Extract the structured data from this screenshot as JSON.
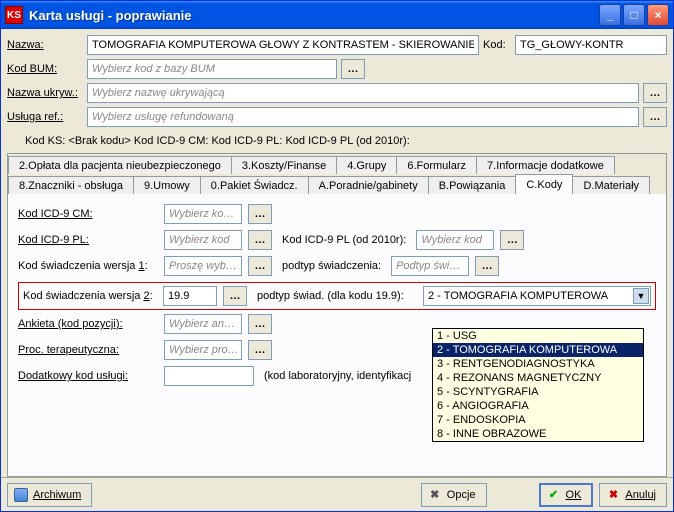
{
  "titlebar": {
    "app_icon_text": "KS",
    "title": "Karta usługi - poprawianie"
  },
  "fields": {
    "nazwa_label": "Nazwa:",
    "nazwa_value": "TOMOGRAFIA KOMPUTEROWA GŁOWY Z KONTRASTEM - SKIEROWANIE",
    "kod_label": "Kod:",
    "kod_value": "TG_GŁOWY-KONTR",
    "kod_bum_label": "Kod BUM:",
    "kod_bum_ph": "Wybierz kod z bazy BUM",
    "nazwa_ukryw_label": "Nazwa ukryw.:",
    "nazwa_ukryw_ph": "Wybierz nazwę ukrywającą",
    "usluga_ref_label": "Usługa ref.:",
    "usluga_ref_ph": "Wybierz usługę refundowaną",
    "kodrow": "Kod KS: <Brak kodu>   Kod ICD-9 CM:   Kod ICD-9 PL:   Kod ICD-9 PL (od 2010r):"
  },
  "tabs_row1": [
    "2.Opłata dla pacjenta nieubezpieczonego",
    "3.Koszty/Finanse",
    "4.Grupy",
    "6.Formularz",
    "7.Informacje dodatkowe"
  ],
  "tabs_row2": [
    "8.Znaczniki - obsługa",
    "9.Umowy",
    "0.Pakiet Świadcz.",
    "A.Poradnie/gabinety",
    "B.Powiązania",
    "C.Kody",
    "D.Materiały"
  ],
  "active_tab": "C.Kody",
  "pane": {
    "icd9cm_label": "Kod ICD-9 CM:",
    "icd9cm_ph": "Wybierz ko…",
    "icd9pl_label": "Kod ICD-9 PL:",
    "icd9pl_ph": "Wybierz kod",
    "icd9pl2010_label": "Kod ICD-9 PL (od 2010r):",
    "icd9pl2010_ph": "Wybierz kod",
    "kodsw1_label_pre": "Kod świadczenia wersja ",
    "kodsw1_label_u": "1",
    "kodsw1_label_post": ":",
    "kodsw1_ph": "Proszę wyb…",
    "podtyp_label": "podtyp świadczenia:",
    "podtyp_ph": "Podtyp świ…",
    "kodsw2_label_pre": "Kod świadczenia wersja ",
    "kodsw2_label_u": "2",
    "kodsw2_label_post": ":",
    "kodsw2_value": "19.9",
    "podtyp2_label": "podtyp świad. (dla kodu 19.9):",
    "podtyp2_value": "2 - TOMOGRAFIA KOMPUTEROWA",
    "ankieta_label": "Ankieta (kod pozycji):",
    "ankieta_ph": "Wybierz an…",
    "proc_label": "Proc. terapeutyczna:",
    "proc_ph": "Wybierz pro…",
    "dodatkowy_label": "Dodatkowy kod usługi:",
    "dodatkowy_note": "(kod laboratoryjny, identyfikacj"
  },
  "dropdown": {
    "options": [
      "1 - USG",
      "2 - TOMOGRAFIA KOMPUTEROWA",
      "3 - RENTGENODIAGNOSTYKA",
      "4 - REZONANS MAGNETYCZNY",
      "5 - SCYNTYGRAFIA",
      "6 - ANGIOGRAFIA",
      "7 - ENDOSKOPIA",
      "8 - INNE OBRAZOWE"
    ],
    "selected_index": 1
  },
  "buttons": {
    "archiwum": "Archiwum",
    "opcje": "Opcje",
    "ok": "OK",
    "anuluj": "Anuluj"
  }
}
